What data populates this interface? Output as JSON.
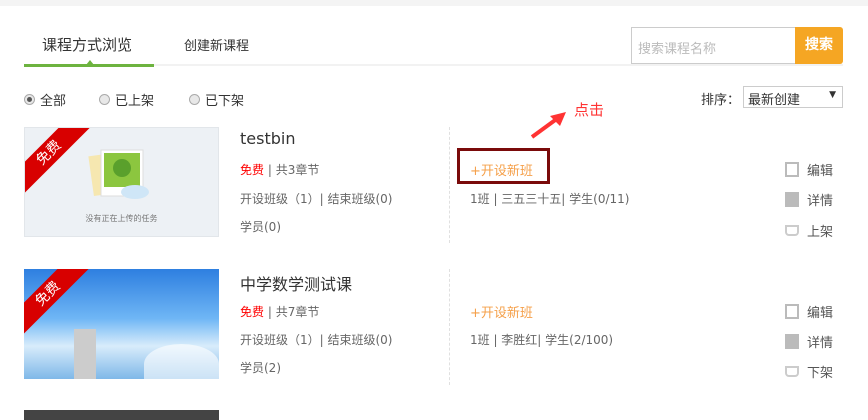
{
  "tabs": [
    {
      "label": "课程方式浏览",
      "active": true
    },
    {
      "label": "创建新课程",
      "active": false
    }
  ],
  "search": {
    "placeholder": "搜索课程名称",
    "button": "搜索"
  },
  "filters": [
    {
      "label": "全部",
      "checked": true
    },
    {
      "label": "已上架",
      "checked": false
    },
    {
      "label": "已下架",
      "checked": false
    }
  ],
  "sort": {
    "label": "排序：",
    "value": "最新创建"
  },
  "annotation": {
    "text": "点击",
    "color": "#ff3333"
  },
  "colors": {
    "accent": "#6db33f",
    "orange": "#f5a623",
    "free": "#ff0000"
  },
  "courses": [
    {
      "badge": "免费",
      "thumb_caption": "没有正在上传的任务",
      "title": "testbin",
      "price": "免费",
      "chapters": "| 共3章节",
      "classes": "开设班级（1）| 结束班级(0)",
      "students": "学员(0)",
      "new_class": "+开设新班",
      "class_info": "1班 | 三五三十五| 学生(0/11)",
      "actions": [
        "编辑",
        "详情",
        "上架"
      ]
    },
    {
      "badge": "免费",
      "title": "中学数学测试课",
      "price": "免费",
      "chapters": "| 共7章节",
      "classes": "开设班级（1）| 结束班级(0)",
      "students": "学员(2)",
      "new_class": "+开设新班",
      "class_info": "1班 | 李胜红| 学生(2/100)",
      "actions": [
        "编辑",
        "详情",
        "下架"
      ]
    }
  ]
}
